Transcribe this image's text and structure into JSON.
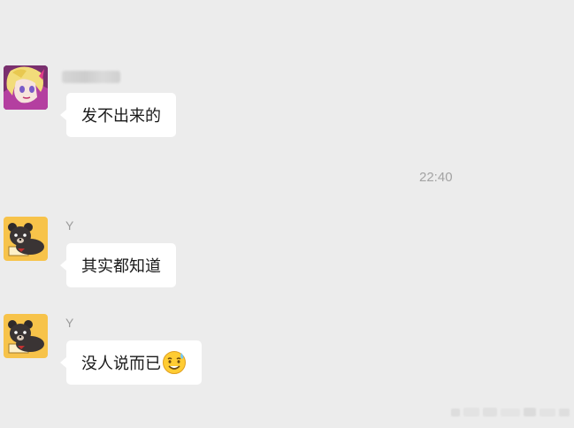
{
  "timestamp": "22:40",
  "messages": [
    {
      "sender": "",
      "sender_obscured": true,
      "avatar": "anime-avatar-icon",
      "text": "发不出来的"
    },
    {
      "sender": "Y",
      "avatar": "bear-avatar-icon",
      "text": "其实都知道"
    },
    {
      "sender": "Y",
      "avatar": "bear-avatar-icon",
      "text": "没人说而已",
      "emoji": "sweat-smile-emoji-icon"
    }
  ],
  "colors": {
    "background": "#ececec",
    "bubble": "#ffffff",
    "sender_text": "#9c9c9c",
    "timestamp_text": "#a3a3a3",
    "bear_avatar_bg": "#f7c34a"
  }
}
